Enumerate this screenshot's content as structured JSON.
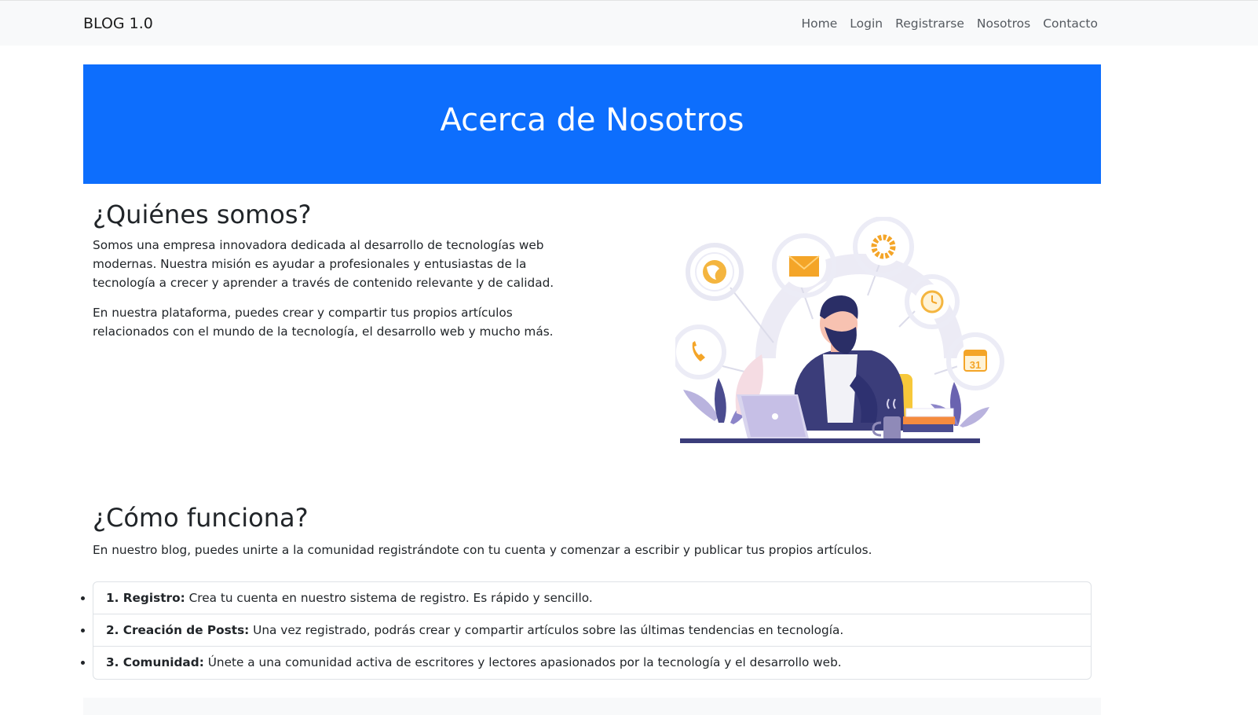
{
  "navbar": {
    "brand": "BLOG 1.0",
    "links": [
      "Home",
      "Login",
      "Registrarse",
      "Nosotros",
      "Contacto"
    ]
  },
  "hero": {
    "title": "Acerca de Nosotros"
  },
  "about": {
    "heading": "¿Quiénes somos?",
    "paragraph1": "Somos una empresa innovadora dedicada al desarrollo de tecnologías web modernas. Nuestra misión es ayudar a profesionales y entusiastas de la tecnología a crecer y aprender a través de contenido relevante y de calidad.",
    "paragraph2": "En nuestra plataforma, puedes crear y compartir tus propios artículos relacionados con el mundo de la tecnología, el desarrollo web y mucho más."
  },
  "illustration": {
    "calendar_day": "31"
  },
  "how": {
    "heading": "¿Cómo funciona?",
    "intro": "En nuestro blog, puedes unirte a la comunidad registrándote con tu cuenta y comenzar a escribir y publicar tus propios artículos.",
    "steps": [
      {
        "label": "1. Registro:",
        "text": " Crea tu cuenta en nuestro sistema de registro. Es rápido y sencillo."
      },
      {
        "label": "2. Creación de Posts:",
        "text": " Una vez registrado, podrás crear y compartir artículos sobre las últimas tendencias en tecnología."
      },
      {
        "label": "3. Comunidad:",
        "text": " Únete a una comunidad activa de escritores y lectores apasionados por la tecnología y el desarrollo web."
      }
    ]
  },
  "colors": {
    "primary": "#0d6efd",
    "navbar_bg": "#f8f9fa",
    "text": "#212529"
  }
}
